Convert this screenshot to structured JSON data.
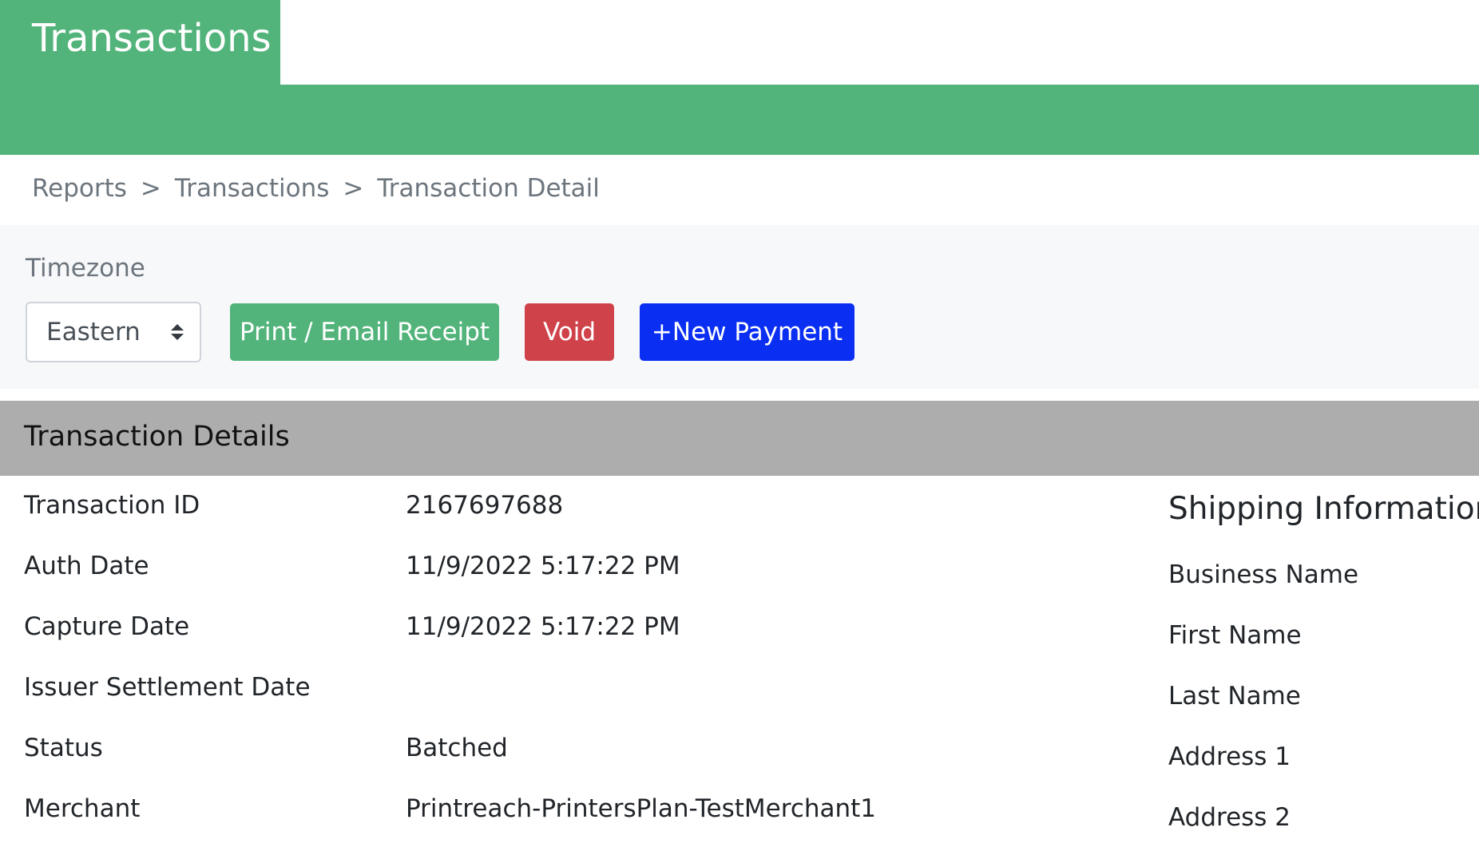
{
  "header": {
    "title": "Transactions"
  },
  "breadcrumb": {
    "items": [
      "Reports",
      "Transactions",
      "Transaction Detail"
    ],
    "separator": ">"
  },
  "toolbar": {
    "timezone_label": "Timezone",
    "timezone_value": "Eastern",
    "receipt_label": "Print / Email Receipt",
    "void_label": "Void",
    "new_payment_label": "+New Payment"
  },
  "details": {
    "title": "Transaction Details",
    "rows": [
      {
        "label": "Transaction ID",
        "value": "2167697688"
      },
      {
        "label": "Auth Date",
        "value": "11/9/2022 5:17:22 PM"
      },
      {
        "label": "Capture Date",
        "value": "11/9/2022 5:17:22 PM"
      },
      {
        "label": "Issuer Settlement Date",
        "value": ""
      },
      {
        "label": "Status",
        "value": "Batched"
      },
      {
        "label": "Merchant",
        "value": "Printreach-PrintersPlan-TestMerchant1"
      }
    ]
  },
  "shipping": {
    "title": "Shipping Information",
    "fields": [
      "Business Name",
      "First Name",
      "Last Name",
      "Address 1",
      "Address 2"
    ]
  },
  "colors": {
    "brand_green": "#52b47a",
    "void_red": "#d0424a",
    "new_payment_blue": "#0a2ef2",
    "section_header_gray": "#adadad",
    "toolbar_bg": "#f7f8fa"
  }
}
